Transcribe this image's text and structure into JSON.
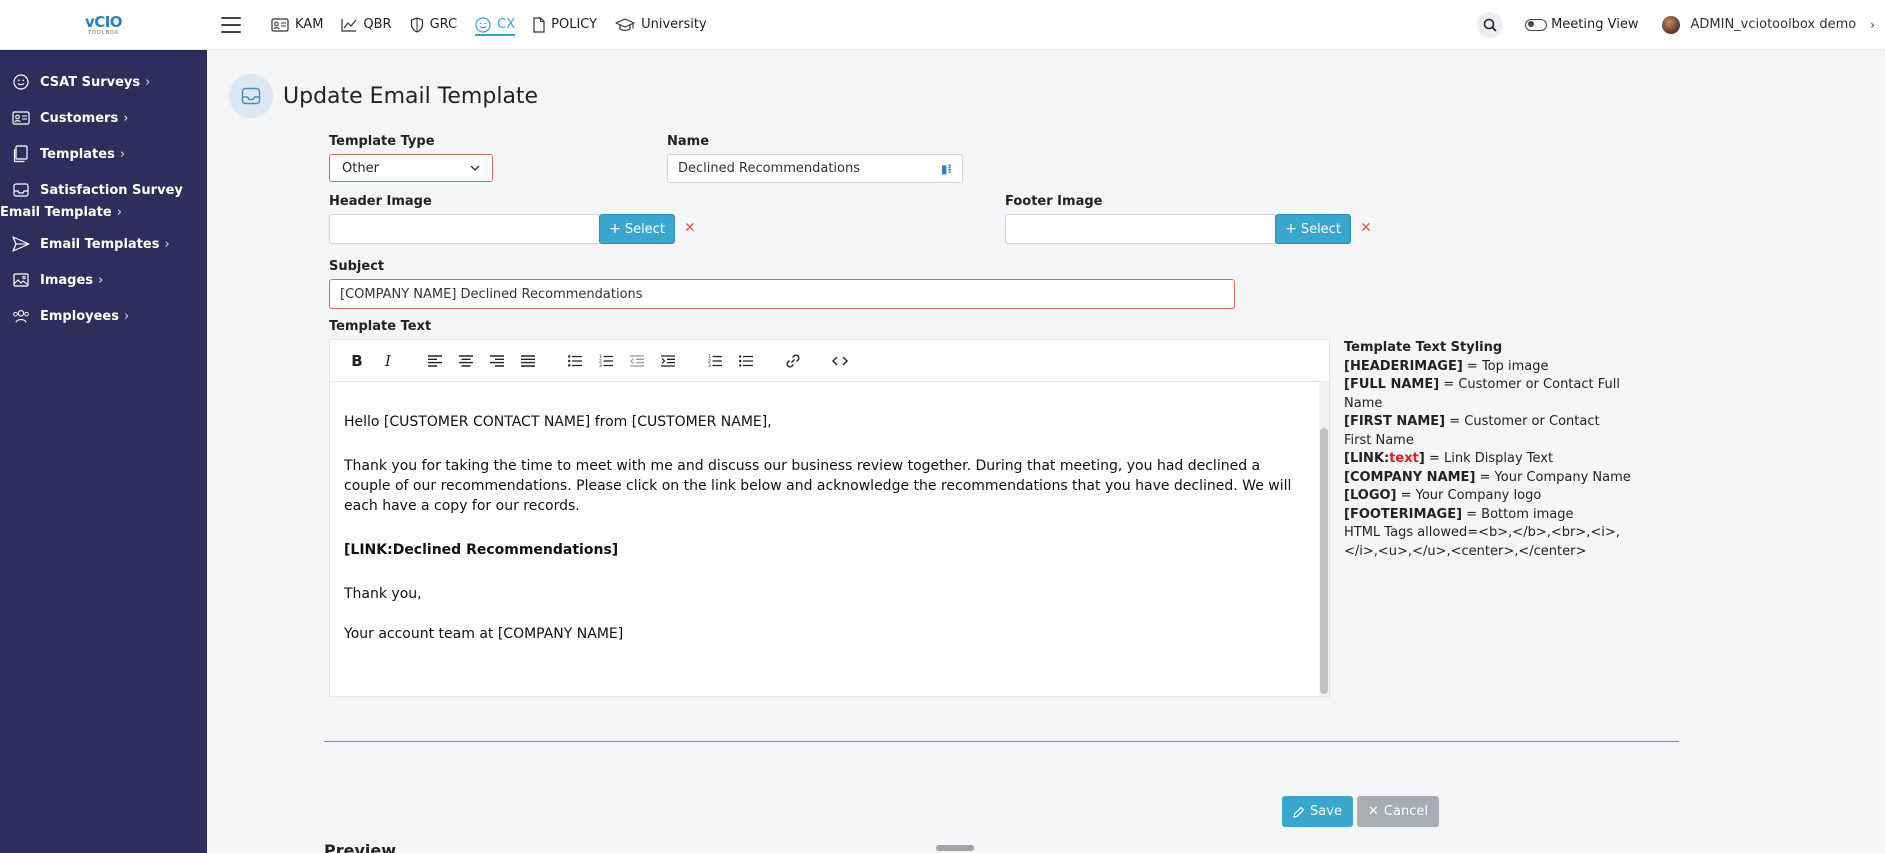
{
  "sidebar": {
    "logo_text": "vCIO",
    "logo_sub": "TOOLBOX",
    "items": [
      {
        "label": "CSAT Surveys",
        "icon": "smile-icon"
      },
      {
        "label": "Customers",
        "icon": "id-card-icon"
      },
      {
        "label": "Templates",
        "icon": "document-icon"
      },
      {
        "label": "Satisfaction Survey",
        "icon": "inbox-icon"
      },
      {
        "label": "Email Template"
      },
      {
        "label": "Email Templates",
        "icon": "send-icon"
      },
      {
        "label": "Images",
        "icon": "image-icon"
      },
      {
        "label": "Employees",
        "icon": "users-icon"
      }
    ]
  },
  "topnav": {
    "items": [
      {
        "label": "KAM",
        "icon": "id-card-icon"
      },
      {
        "label": "QBR",
        "icon": "chart-line-icon"
      },
      {
        "label": "GRC",
        "icon": "shield-icon"
      },
      {
        "label": "CX",
        "icon": "smile-icon",
        "active": true
      },
      {
        "label": "POLICY",
        "icon": "document-icon"
      },
      {
        "label": "University",
        "icon": "graduation-cap-icon"
      }
    ],
    "meeting_view": "Meeting View",
    "user_name": "ADMIN_vciotoolbox demo"
  },
  "page": {
    "title": "Update Email Template"
  },
  "form": {
    "template_type_label": "Template Type",
    "template_type_value": "Other",
    "name_label": "Name",
    "name_value": "Declined Recommendations",
    "header_image_label": "Header Image",
    "footer_image_label": "Footer Image",
    "select_label": "Select",
    "subject_label": "Subject",
    "subject_value": "[COMPANY NAME] Declined Recommendations",
    "template_text_label": "Template Text"
  },
  "editor": {
    "greeting": "Hello [CUSTOMER CONTACT NAME] from [CUSTOMER NAME],",
    "body": "Thank you for taking the time to meet with me and discuss our business review together. During that meeting, you had declined a couple of our recommendations. Please click on the link below and acknowledge the recommendations that you have declined. We will each have a copy for our records.",
    "link": "[LINK:Declined Recommendations]",
    "thanks": "Thank you,",
    "signature": "Your account team at [COMPANY NAME]"
  },
  "styling_help": {
    "title": "Template Text Styling",
    "lines": [
      {
        "key": "[HEADERIMAGE]",
        "desc": " = Top image"
      },
      {
        "key": "[FULL NAME]",
        "desc": " = Customer or Contact Full Name"
      },
      {
        "key": "[FIRST NAME]",
        "desc": " = Customer or Contact First Name"
      },
      {
        "key_pre": "[LINK:",
        "key_red": "text",
        "key_post": "]",
        "desc": " = Link Display Text"
      },
      {
        "key": "[COMPANY NAME]",
        "desc": " = Your Company Name"
      },
      {
        "key": "[LOGO]",
        "desc": " = Your Company logo"
      },
      {
        "key": "[FOOTERIMAGE]",
        "desc": " = Bottom image"
      }
    ],
    "html_tags": "HTML Tags allowed=<b>,</b>,<br>,<i>,</i>,<u>,</u>,<center>,</center>"
  },
  "actions": {
    "save": "Save",
    "cancel": "Cancel"
  },
  "preview_label": "Preview",
  "colors": {
    "sidebar_bg": "#2c2f5b",
    "accent": "#3aa6cd",
    "error_border": "#d26b6b",
    "required_red": "#e02020"
  }
}
